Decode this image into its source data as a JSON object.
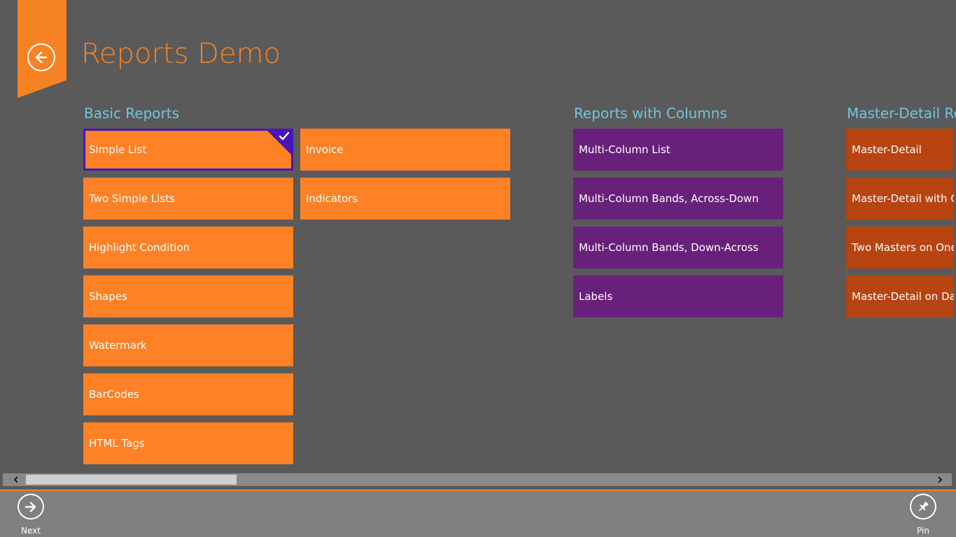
{
  "header": {
    "title": "Reports Demo",
    "back_icon": "arrow-left-icon"
  },
  "colors": {
    "accent": "#f78224",
    "group_header": "#72c4dc",
    "tile_orange": "#fe8126",
    "tile_purple": "#68217a",
    "tile_rust": "#b84411",
    "selection": "#4617b4"
  },
  "groups": [
    {
      "title": "Basic Reports",
      "tiles": [
        "Simple List",
        "Two Simple Lists",
        "Highlight Condition",
        "Shapes",
        "Watermark",
        "BarCodes",
        "HTML Tags",
        "Invoice",
        "Indicators"
      ],
      "selected": "Simple List"
    },
    {
      "title": "Reports with Columns",
      "tiles": [
        "Multi-Column List",
        "Multi-Column Bands, Across-Down",
        "Multi-Column Bands, Down-Across",
        "Labels"
      ]
    },
    {
      "title": "Master-Detail Rep",
      "tiles": [
        "Master-Detail",
        "Master-Detail with Col",
        "Two Masters on One D",
        "Master-Detail on Data"
      ]
    }
  ],
  "app_bar": {
    "next_label": "Next",
    "next_icon": "arrow-right-icon",
    "pin_label": "Pin",
    "pin_icon": "pin-icon"
  },
  "scrollbar": {
    "left_icon": "chevron-left-icon",
    "right_icon": "chevron-right-icon"
  }
}
